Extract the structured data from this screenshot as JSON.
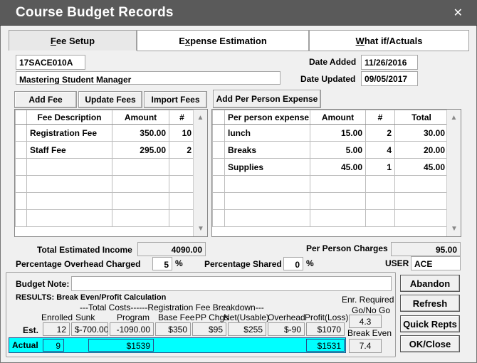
{
  "window": {
    "title": "Course Budget Records"
  },
  "tabs": [
    {
      "label": "Fee Setup",
      "accel": "F",
      "rest": "ee Setup"
    },
    {
      "label": "Expense Estimation",
      "pre": "E",
      "accel": "x",
      "rest": "pense Estimation"
    },
    {
      "label": "What if/Actuals",
      "accel": "W",
      "rest": "hat if/Actuals"
    }
  ],
  "course": {
    "code": "17SACE010A",
    "name": "Mastering Student Manager",
    "date_added_label": "Date Added",
    "date_added": "11/26/2016",
    "date_updated_label": "Date Updated",
    "date_updated": "09/05/2017"
  },
  "buttons": {
    "add_fee": "Add Fee",
    "update_fees": "Update Fees",
    "import_fees": "Import Fees",
    "add_per_person": "Add Per Person Expense",
    "abandon": "Abandon",
    "refresh": "Refresh",
    "quick_repts": "Quick Repts",
    "ok_close": "OK/Close"
  },
  "fees_table": {
    "headers": [
      "Fee Description",
      "Amount",
      "#"
    ],
    "rows": [
      [
        "Registration Fee",
        "350.00",
        "10"
      ],
      [
        "Staff Fee",
        "295.00",
        "2"
      ]
    ]
  },
  "expense_table": {
    "headers": [
      "Per person expense",
      "Amount",
      "#",
      "Total"
    ],
    "rows": [
      [
        "lunch",
        "15.00",
        "2",
        "30.00"
      ],
      [
        "Breaks",
        "5.00",
        "4",
        "20.00"
      ],
      [
        "Supplies",
        "45.00",
        "1",
        "45.00"
      ]
    ]
  },
  "totals": {
    "income_label": "Total Estimated Income",
    "income": "4090.00",
    "per_person_label": "Per Person Charges",
    "per_person": "95.00",
    "overhead_label": "Percentage Overhead Charged",
    "overhead": "5",
    "shared_label": "Percentage Shared",
    "shared": "0",
    "pct": "%",
    "user_label": "USER",
    "user": "ACE"
  },
  "budget_note": {
    "label": "Budget Note:",
    "value": ""
  },
  "results": {
    "title": "RESULTS: Break Even/Profit Calculation",
    "breakdown_title": "---Total Costs------Registration Fee Breakdown---",
    "enr_required": "Enr. Required",
    "go_no_go": "Go/No Go",
    "enr_value": "4.3",
    "break_even_label": "Break Even",
    "break_even": "7.4",
    "columns": [
      "Enrolled",
      "Sunk",
      "Program",
      "Base Fee",
      "PP Chgs",
      "Net(Usable)",
      "Overhead",
      "Profit(Loss)"
    ],
    "est_label": "Est.",
    "est": [
      "12",
      "$-700.00",
      "-1090.00",
      "$350",
      "$95",
      "$255",
      "$-90",
      "$1070"
    ],
    "actual_label": "Actual",
    "actual_enrolled": "9",
    "actual_cost": "$1539",
    "actual_profit": "$1531"
  },
  "icons": {
    "close": "close-icon",
    "scroll_up": "scroll-up-icon",
    "scroll_down": "scroll-down-icon"
  },
  "colors": {
    "titlebar": "#5a5a5a",
    "actual_bar": "#00ffff"
  }
}
